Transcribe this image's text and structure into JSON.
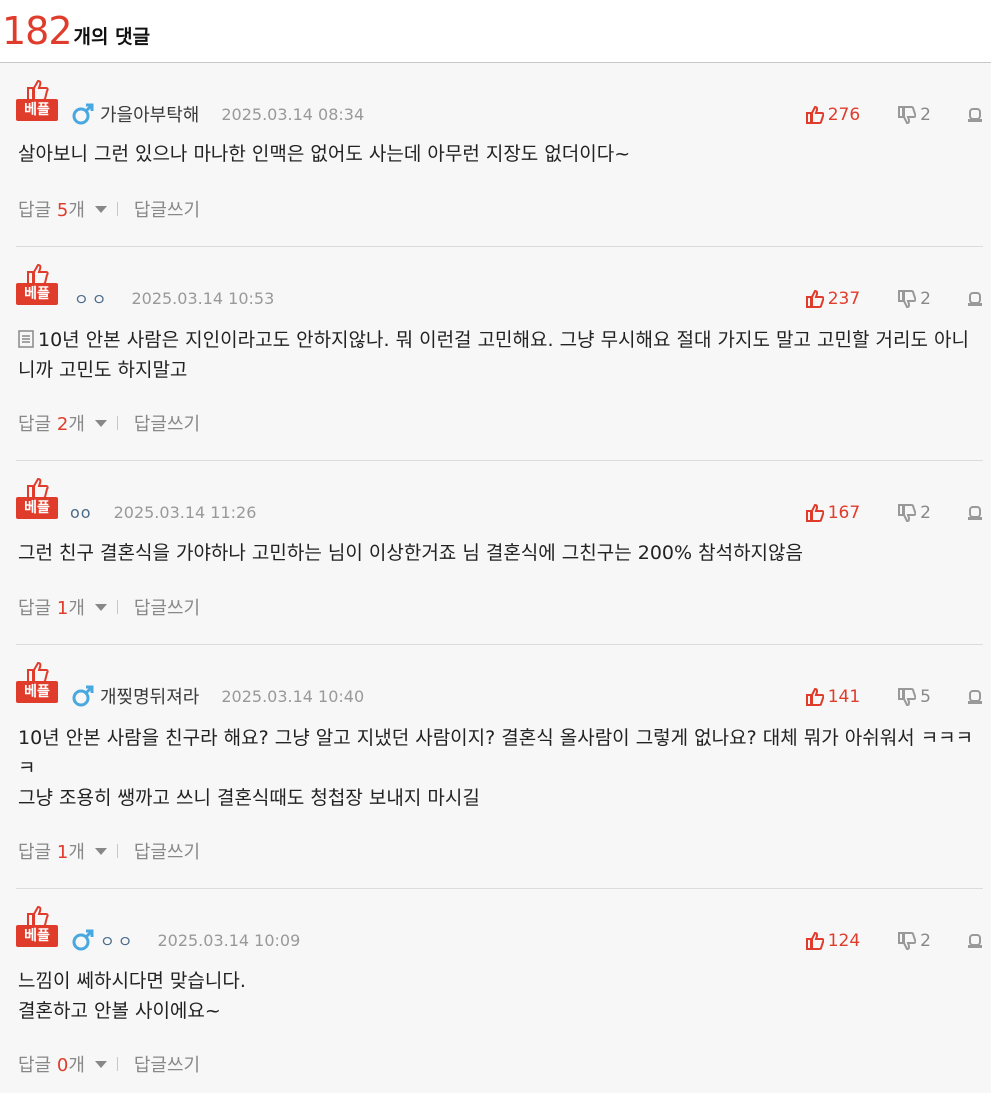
{
  "header": {
    "count": "182",
    "label": "개의 댓글"
  },
  "colors": {
    "accent": "#e03c2c",
    "muted": "#999999"
  },
  "best_badge": "베플",
  "comments": [
    {
      "gender_icon": "male-icon",
      "nickname": "가을아부탁해",
      "date": "2025.03.14 08:34",
      "likes": "276",
      "dislikes": "2",
      "text": "살아보니 그런 있으나 마나한 인맥은 없어도 사는데 아무런 지장도 없더이다~",
      "reply_label": "답글",
      "reply_count": "5",
      "reply_unit": "개",
      "write_reply": "답글쓰기"
    },
    {
      "gender_icon": "",
      "nickname": "ㅇㅇ",
      "date": "2025.03.14 10:53",
      "likes": "237",
      "dislikes": "2",
      "text": "10년 안본 사람은 지인이라고도 안하지않나. 뭐 이런걸 고민해요. 그냥 무시해요 절대 가지도 말고 고민할 거리도 아니니까 고민도 하지말고",
      "has_memo": true,
      "reply_label": "답글",
      "reply_count": "2",
      "reply_unit": "개",
      "write_reply": "답글쓰기"
    },
    {
      "gender_icon": "",
      "nickname": "oo",
      "date": "2025.03.14 11:26",
      "likes": "167",
      "dislikes": "2",
      "text": "그런 친구 결혼식을 가야하나 고민하는 님이 이상한거죠 님 결혼식에 그친구는 200% 참석하지않음",
      "reply_label": "답글",
      "reply_count": "1",
      "reply_unit": "개",
      "write_reply": "답글쓰기"
    },
    {
      "gender_icon": "male-icon",
      "nickname": "개찢명뒤져라",
      "date": "2025.03.14 10:40",
      "likes": "141",
      "dislikes": "5",
      "text": "10년 안본 사람을 친구라 해요? 그냥 알고 지냈던 사람이지? 결혼식 올사람이 그렇게 없나요? 대체 뭐가 아쉬워서 ㅋㅋㅋㅋ\n그냥 조용히 쌩까고 쓰니 결혼식때도 청첩장 보내지 마시길",
      "reply_label": "답글",
      "reply_count": "1",
      "reply_unit": "개",
      "write_reply": "답글쓰기"
    },
    {
      "gender_icon": "male-icon",
      "nickname": "ㅇㅇ",
      "date": "2025.03.14 10:09",
      "likes": "124",
      "dislikes": "2",
      "text": "느낌이 쎄하시다면 맞습니다.\n결혼하고 안볼 사이에요~",
      "reply_label": "답글",
      "reply_count": "0",
      "reply_unit": "개",
      "write_reply": "답글쓰기"
    }
  ]
}
